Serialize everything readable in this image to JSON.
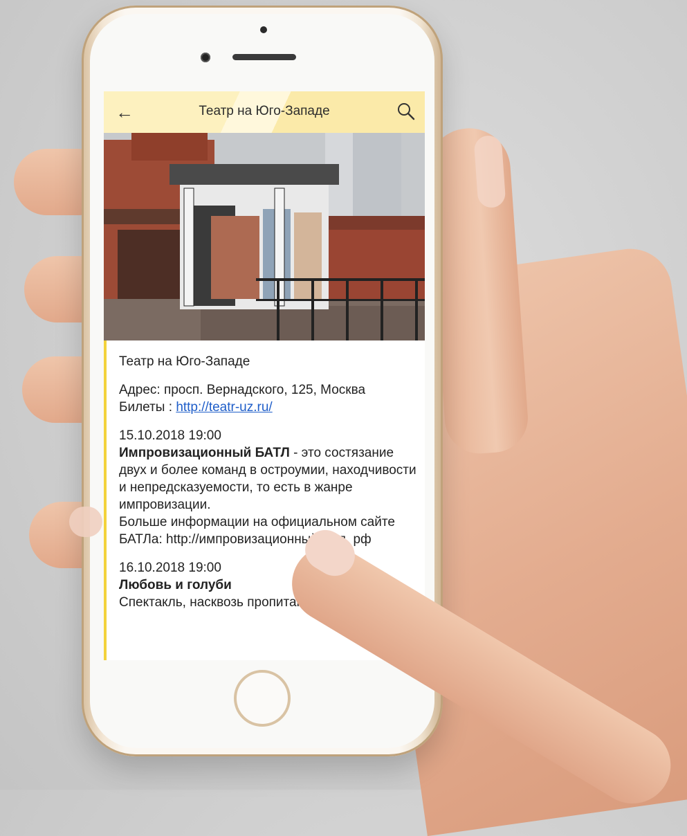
{
  "app": {
    "title": "Театр на Юго-Западе"
  },
  "venue": {
    "name": "Театр на Юго-Западе",
    "address": "Адрес: просп. Вернадского, 125, Москва",
    "tickets_label": "Билеты : ",
    "tickets_link": "http://teatr-uz.ru/"
  },
  "events": [
    {
      "datetime": "15.10.2018 19:00",
      "title": "Импровизационный БАТЛ",
      "description": " - это состязание двух и более команд в остроумии, находчивости и непредсказуемости, то есть в жанре импровизации.",
      "more": "Больше информации на официальном сайте БАТЛа: http://импровизационныйбатл. рф"
    },
    {
      "datetime": "16.10.2018 19:00",
      "title": "Любовь и голуби",
      "description": "Спектакль, насквозь пропитанный"
    }
  ],
  "icons": {
    "back": "arrow-left-icon",
    "search": "search-icon"
  },
  "colors": {
    "topbar": "#fdf1bf",
    "accent_line": "#f3d23c",
    "link": "#1f5ec9"
  }
}
